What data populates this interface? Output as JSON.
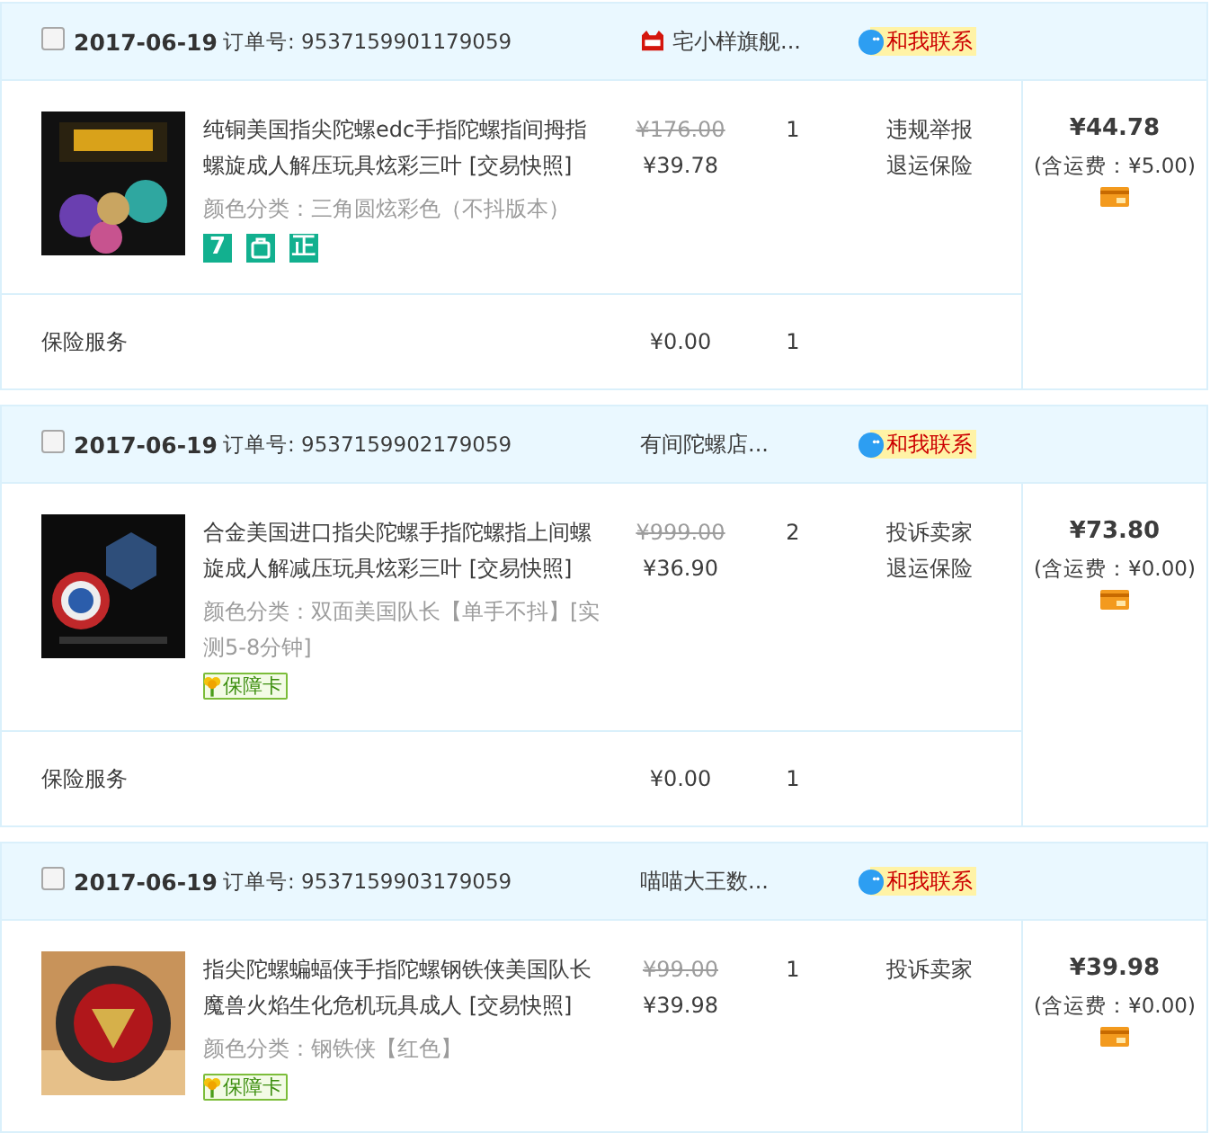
{
  "orders": [
    {
      "selected": false,
      "date": "2017-06-19",
      "order_label": "订单号:",
      "order_no": "9537159901179059",
      "shop": {
        "name": "宅小样旗舰...",
        "tmall": true
      },
      "contact": "和我联系",
      "total": "¥44.78",
      "shipping": "(含运费：¥5.00)",
      "items": [
        {
          "kind": "product",
          "title": "纯铜美国指尖陀螺edc手指陀螺指间拇指螺旋成人解压玩具炫彩三叶",
          "snapshot": "[交易快照]",
          "spec": "颜色分类：三角圆炫彩色（不抖版本）",
          "original_price": "¥176.00",
          "price": "¥39.78",
          "qty": "1",
          "actions": [
            "违规举报",
            "退运保险"
          ],
          "badges": [
            {
              "kind": "tile",
              "text": "7"
            },
            {
              "kind": "bag"
            },
            {
              "kind": "tile",
              "text": "正"
            }
          ]
        },
        {
          "kind": "service",
          "title": "保险服务",
          "price": "¥0.00",
          "qty": "1"
        }
      ]
    },
    {
      "selected": false,
      "date": "2017-06-19",
      "order_label": "订单号:",
      "order_no": "9537159902179059",
      "shop": {
        "name": "有间陀螺店...",
        "tmall": false
      },
      "contact": "和我联系",
      "total": "¥73.80",
      "shipping": "(含运费：¥0.00)",
      "items": [
        {
          "kind": "product",
          "title": "合金美国进口指尖陀螺手指陀螺指上间螺旋成人解减压玩具炫彩三叶",
          "snapshot": "[交易快照]",
          "spec": "颜色分类：双面美国队长【单手不抖】[实测5-8分钟]",
          "original_price": "¥999.00",
          "price": "¥36.90",
          "qty": "2",
          "actions": [
            "投诉卖家",
            "退运保险"
          ],
          "badges": [
            {
              "kind": "card",
              "text": "保障卡"
            }
          ]
        },
        {
          "kind": "service",
          "title": "保险服务",
          "price": "¥0.00",
          "qty": "1"
        }
      ]
    },
    {
      "selected": false,
      "date": "2017-06-19",
      "order_label": "订单号:",
      "order_no": "9537159903179059",
      "shop": {
        "name": "喵喵大王数...",
        "tmall": false
      },
      "contact": "和我联系",
      "total": "¥39.98",
      "shipping": "(含运费：¥0.00)",
      "items": [
        {
          "kind": "product",
          "title": "指尖陀螺蝙蝠侠手指陀螺钢铁侠美国队长魔兽火焰生化危机玩具成人",
          "snapshot": "[交易快照]",
          "spec": "颜色分类：钢铁侠【红色】",
          "original_price": "¥99.00",
          "price": "¥39.98",
          "qty": "1",
          "actions": [
            "投诉卖家"
          ],
          "badges": [
            {
              "kind": "card",
              "text": "保障卡"
            }
          ]
        }
      ]
    }
  ]
}
